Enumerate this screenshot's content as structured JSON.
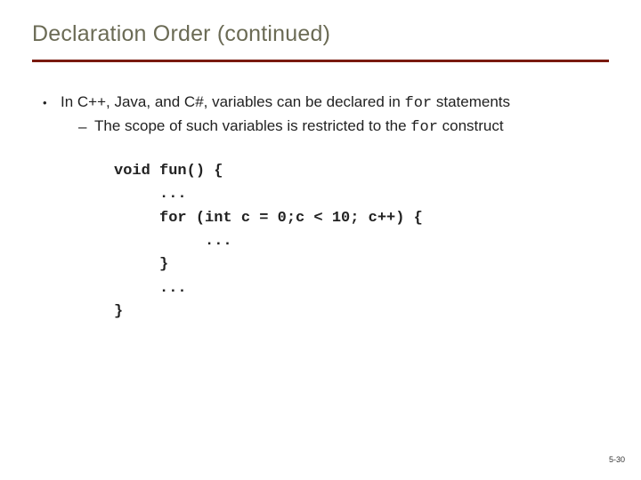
{
  "title": "Declaration Order (continued)",
  "bullet": {
    "pre": "In C++, Java, and C#, variables can be declared in ",
    "code": "for",
    "post": " statements"
  },
  "sub": {
    "pre": "The scope of such variables is restricted to the ",
    "code": "for",
    "post": " construct"
  },
  "code": {
    "l1": "void fun() {",
    "l2": "     ...",
    "l3": "     for (int c = 0;c < 10; c++) {",
    "l4": "          ...",
    "l5": "     }",
    "l6": "     ...",
    "l7": "}"
  },
  "footer": "5-30"
}
